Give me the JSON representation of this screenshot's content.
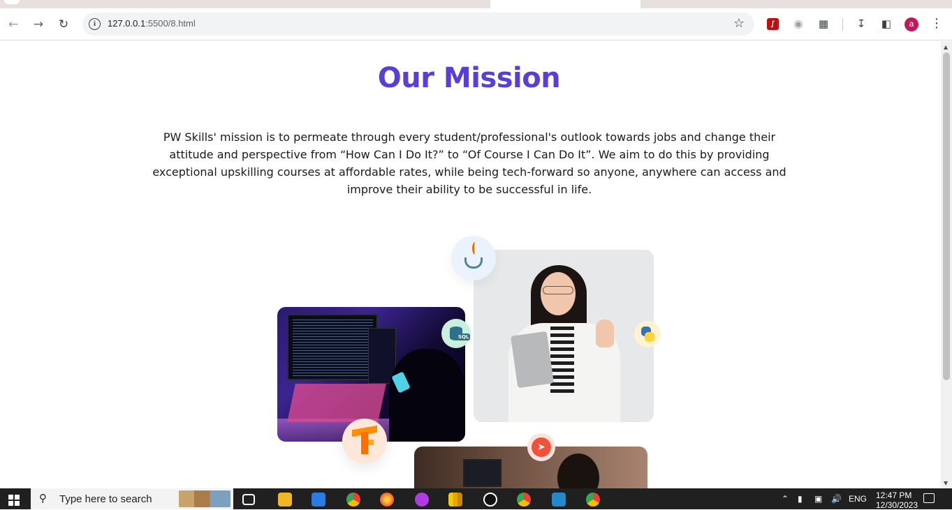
{
  "browser": {
    "url_host": "127.0.0.1",
    "url_path": ":5500/8.html",
    "profile_initial": "a"
  },
  "page": {
    "title": "Our Mission",
    "mission_text": "PW Skills' mission is to permeate through every student/professional's outlook towards jobs and change their attitude and perspective from “How Can I Do It?” to “Of Course I Can Do It”. We aim to do this by providing exceptional upskilling courses at affordable rates, while being tech-forward so anyone, anywhere can access and improve their ability to be successful in life.",
    "badges": {
      "sql_label": "SQL"
    },
    "colors": {
      "title": "#5a3fd6",
      "text": "#1a1a1a"
    }
  },
  "taskbar": {
    "search_placeholder": "Type here to search",
    "language": "ENG",
    "time": "12:47 PM",
    "date": "12/30/2023"
  }
}
